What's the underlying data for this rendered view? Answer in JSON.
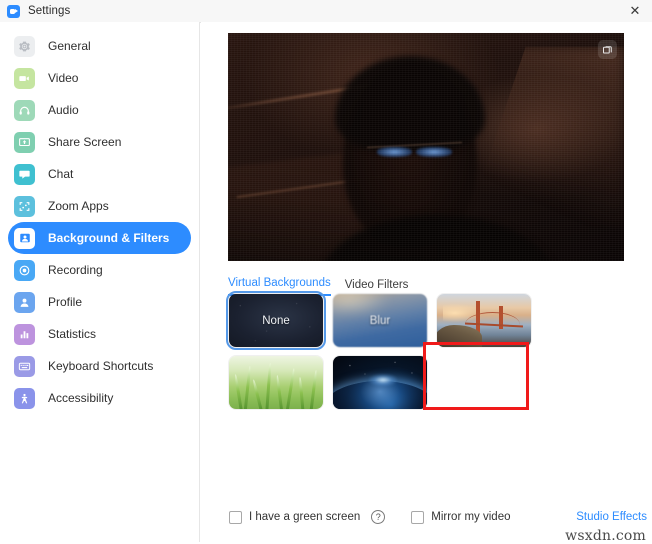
{
  "window": {
    "title": "Settings",
    "logo_icon": "zoom-logo-icon",
    "close_icon": "✕"
  },
  "sidebar": {
    "items": [
      {
        "label": "General",
        "icon": "gear-icon",
        "color": "#c9ccd1",
        "active": false
      },
      {
        "label": "Video",
        "icon": "video-camera-icon",
        "color": "#8cc63f",
        "active": false
      },
      {
        "label": "Audio",
        "icon": "headphones-icon",
        "color": "#5cbf8a",
        "active": false
      },
      {
        "label": "Share Screen",
        "icon": "share-screen-icon",
        "color": "#34b78f",
        "active": false
      },
      {
        "label": "Chat",
        "icon": "chat-bubble-icon",
        "color": "#22b4c6",
        "active": false
      },
      {
        "label": "Zoom Apps",
        "icon": "zoom-apps-icon",
        "color": "#33b0d6",
        "active": false
      },
      {
        "label": "Background & Filters",
        "icon": "background-filters-icon",
        "color": "#2d8cff",
        "active": true
      },
      {
        "label": "Recording",
        "icon": "recording-icon",
        "color": "#3d9bf0",
        "active": false
      },
      {
        "label": "Profile",
        "icon": "profile-person-icon",
        "color": "#5f9ded",
        "active": false
      },
      {
        "label": "Statistics",
        "icon": "statistics-bars-icon",
        "color": "#b287d8",
        "active": false
      },
      {
        "label": "Keyboard Shortcuts",
        "icon": "keyboard-icon",
        "color": "#8f8fe0",
        "active": false
      },
      {
        "label": "Accessibility",
        "icon": "accessibility-icon",
        "color": "#7b87e8",
        "active": false
      }
    ]
  },
  "main": {
    "preview": {
      "popout_icon": "pop-out-window-icon",
      "description": "Camera preview showing a dimly lit person wearing glasses"
    },
    "tabs": [
      {
        "label": "Virtual Backgrounds",
        "active": true
      },
      {
        "label": "Video Filters",
        "active": false
      }
    ],
    "add_button_icon": "plus-circle-icon",
    "backgrounds": [
      {
        "name": "None",
        "label": "None",
        "style": "th-none",
        "selected": true
      },
      {
        "name": "Blur",
        "label": "Blur",
        "style": "th-blur",
        "selected": false
      },
      {
        "name": "Golden Gate Bridge",
        "label": "",
        "style": "th-bridge",
        "selected": false
      },
      {
        "name": "Grass",
        "label": "",
        "style": "th-grass",
        "selected": false
      },
      {
        "name": "Earth From Space",
        "label": "",
        "style": "th-earth",
        "selected": false
      }
    ],
    "options": [
      {
        "label": "I have a green screen",
        "checked": false,
        "help": "?"
      },
      {
        "label": "Mirror my video",
        "checked": false
      }
    ],
    "studio_effects_label": "Studio Effects",
    "annotation": {
      "target": "None",
      "color": "#f01a1a"
    }
  },
  "watermark": "wsxdn.com",
  "colors": {
    "accent": "#2d8cff",
    "annotation": "#f01a1a",
    "titlebar": "#f7f7f7"
  }
}
